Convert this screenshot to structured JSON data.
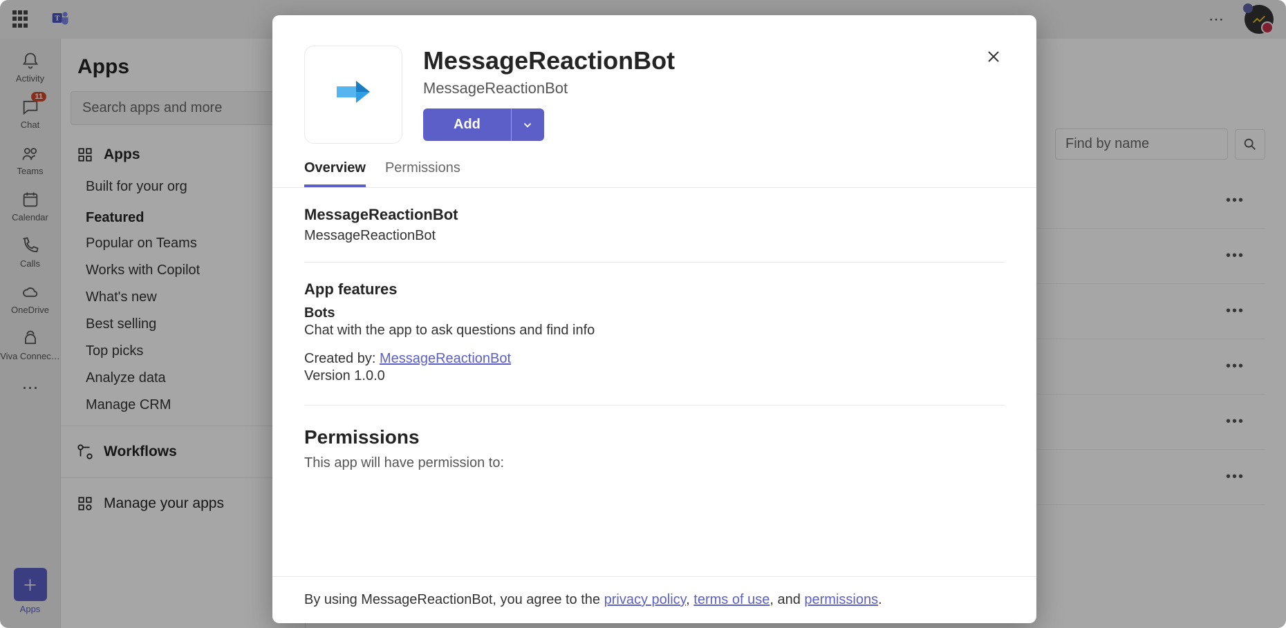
{
  "titleBar": {
    "moreGlyph": "⋯"
  },
  "rail": {
    "items": [
      {
        "key": "activity",
        "label": "Activity"
      },
      {
        "key": "chat",
        "label": "Chat",
        "badge": "11"
      },
      {
        "key": "teams",
        "label": "Teams"
      },
      {
        "key": "calendar",
        "label": "Calendar"
      },
      {
        "key": "calls",
        "label": "Calls"
      },
      {
        "key": "onedrive",
        "label": "OneDrive"
      },
      {
        "key": "viva",
        "label": "Viva Connec…"
      }
    ],
    "moreGlyph": "⋯",
    "appsLabel": "Apps",
    "appsGlyph": "＋"
  },
  "side": {
    "title": "Apps",
    "searchPlaceholder": "Search apps and more",
    "appsSection": "Apps",
    "builtForOrg": "Built for your org",
    "featuredHeader": "Featured",
    "featured": [
      "Popular on Teams",
      "Works with Copilot",
      "What's new",
      "Best selling",
      "Top picks",
      "Analyze data",
      "Manage CRM"
    ],
    "workflows": "Workflows",
    "manage": "Manage your apps"
  },
  "main": {
    "findPlaceholder": "Find by name",
    "rowMore": "•••"
  },
  "modal": {
    "title": "MessageReactionBot",
    "subtitle": "MessageReactionBot",
    "addLabel": "Add",
    "tabs": {
      "overview": "Overview",
      "permissions": "Permissions"
    },
    "overview": {
      "name": "MessageReactionBot",
      "desc": "MessageReactionBot",
      "featuresHeader": "App features",
      "botsLabel": "Bots",
      "botsDesc": "Chat with the app to ask questions and find info",
      "createdByPrefix": "Created by: ",
      "createdByLink": "MessageReactionBot",
      "version": "Version 1.0.0",
      "permHeader": "Permissions",
      "permIntro": "This app will have permission to:"
    },
    "footer": {
      "prefix": "By using MessageReactionBot, you agree to the ",
      "privacy": "privacy policy",
      "sep1": ", ",
      "terms": "terms of use",
      "sep2": ", and ",
      "permissions": "permissions",
      "suffix": "."
    }
  }
}
